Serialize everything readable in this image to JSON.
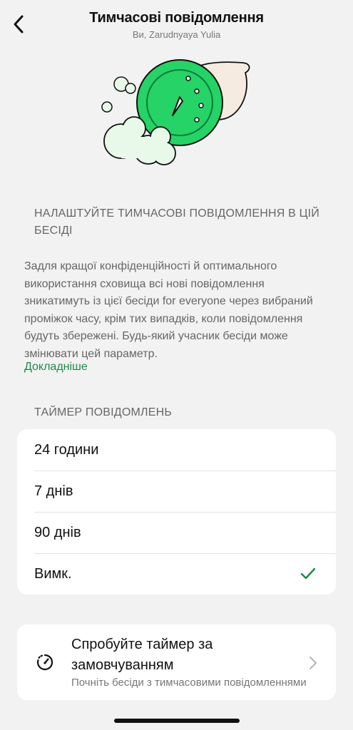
{
  "header": {
    "title": "Тимчасові повідомлення",
    "subtitle": "Ви, Zarudnyaya Yulia"
  },
  "section": {
    "title": "НАЛАШТУЙТЕ ТИМЧАСОВІ ПОВІДОМЛЕННЯ В ЦІЙ БЕСІДІ",
    "description": "Задля кращої конфіденційності й оптимального використання сховища всі нові повідомлення зникатимуть із цієї бесіди for everyone через вибраний проміжок часу, крім тих випадків, коли повідомлення будуть збережені. Будь-який учасник бесіди може змінювати цей параметр.",
    "learn_more": "Докладніше"
  },
  "timer": {
    "title": "ТАЙМЕР ПОВІДОМЛЕНЬ",
    "options": [
      {
        "label": "24 години",
        "selected": false
      },
      {
        "label": "7 днів",
        "selected": false
      },
      {
        "label": "90 днів",
        "selected": false
      },
      {
        "label": "Вимк.",
        "selected": true
      }
    ]
  },
  "default_timer": {
    "title": "Спробуйте таймер за замовчуванням",
    "subtitle": "Почніть бесіди з тимчасовими повідомленнями"
  },
  "colors": {
    "accent_green": "#1a8a4a",
    "illustration_green": "#25d366",
    "background": "#f2f2f2"
  },
  "icons": [
    "back-icon",
    "check-icon",
    "timer-icon",
    "chevron-right-icon"
  ]
}
